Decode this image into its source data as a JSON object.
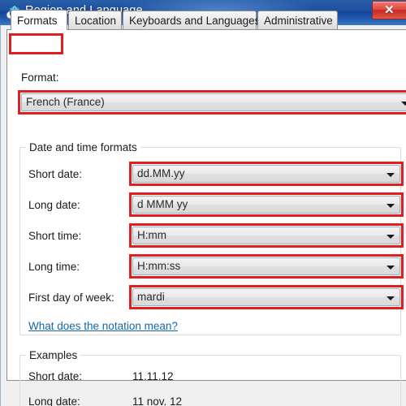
{
  "window": {
    "title": "Region and Language",
    "icon": "region-language-globe-clock-icon",
    "close_label": "✕",
    "titlebar_color": "#1d50a0",
    "close_color": "#c62a20"
  },
  "tabs": [
    {
      "label": "Formats",
      "selected": true
    },
    {
      "label": "Location",
      "selected": false
    },
    {
      "label": "Keyboards and Languages",
      "selected": false
    },
    {
      "label": "Administrative",
      "selected": false
    }
  ],
  "format_section": {
    "label": "Format:",
    "value": "French (France)"
  },
  "date_time_group": {
    "legend": "Date and time formats",
    "rows": [
      {
        "label": "Short date:",
        "value": "dd.MM.yy"
      },
      {
        "label": "Long date:",
        "value": "d MMM yy"
      },
      {
        "label": "Short time:",
        "value": "H:mm"
      },
      {
        "label": "Long time:",
        "value": "H:mm:ss"
      },
      {
        "label": "First day of week:",
        "value": "mardi"
      }
    ],
    "notation_link": "What does the notation mean?"
  },
  "examples_group": {
    "legend": "Examples",
    "rows": [
      {
        "label": "Short date:",
        "value": "11.11.12"
      },
      {
        "label": "Long date:",
        "value": "11 nov. 12"
      }
    ]
  },
  "annotations": {
    "color": "#e02020",
    "count": 7
  }
}
